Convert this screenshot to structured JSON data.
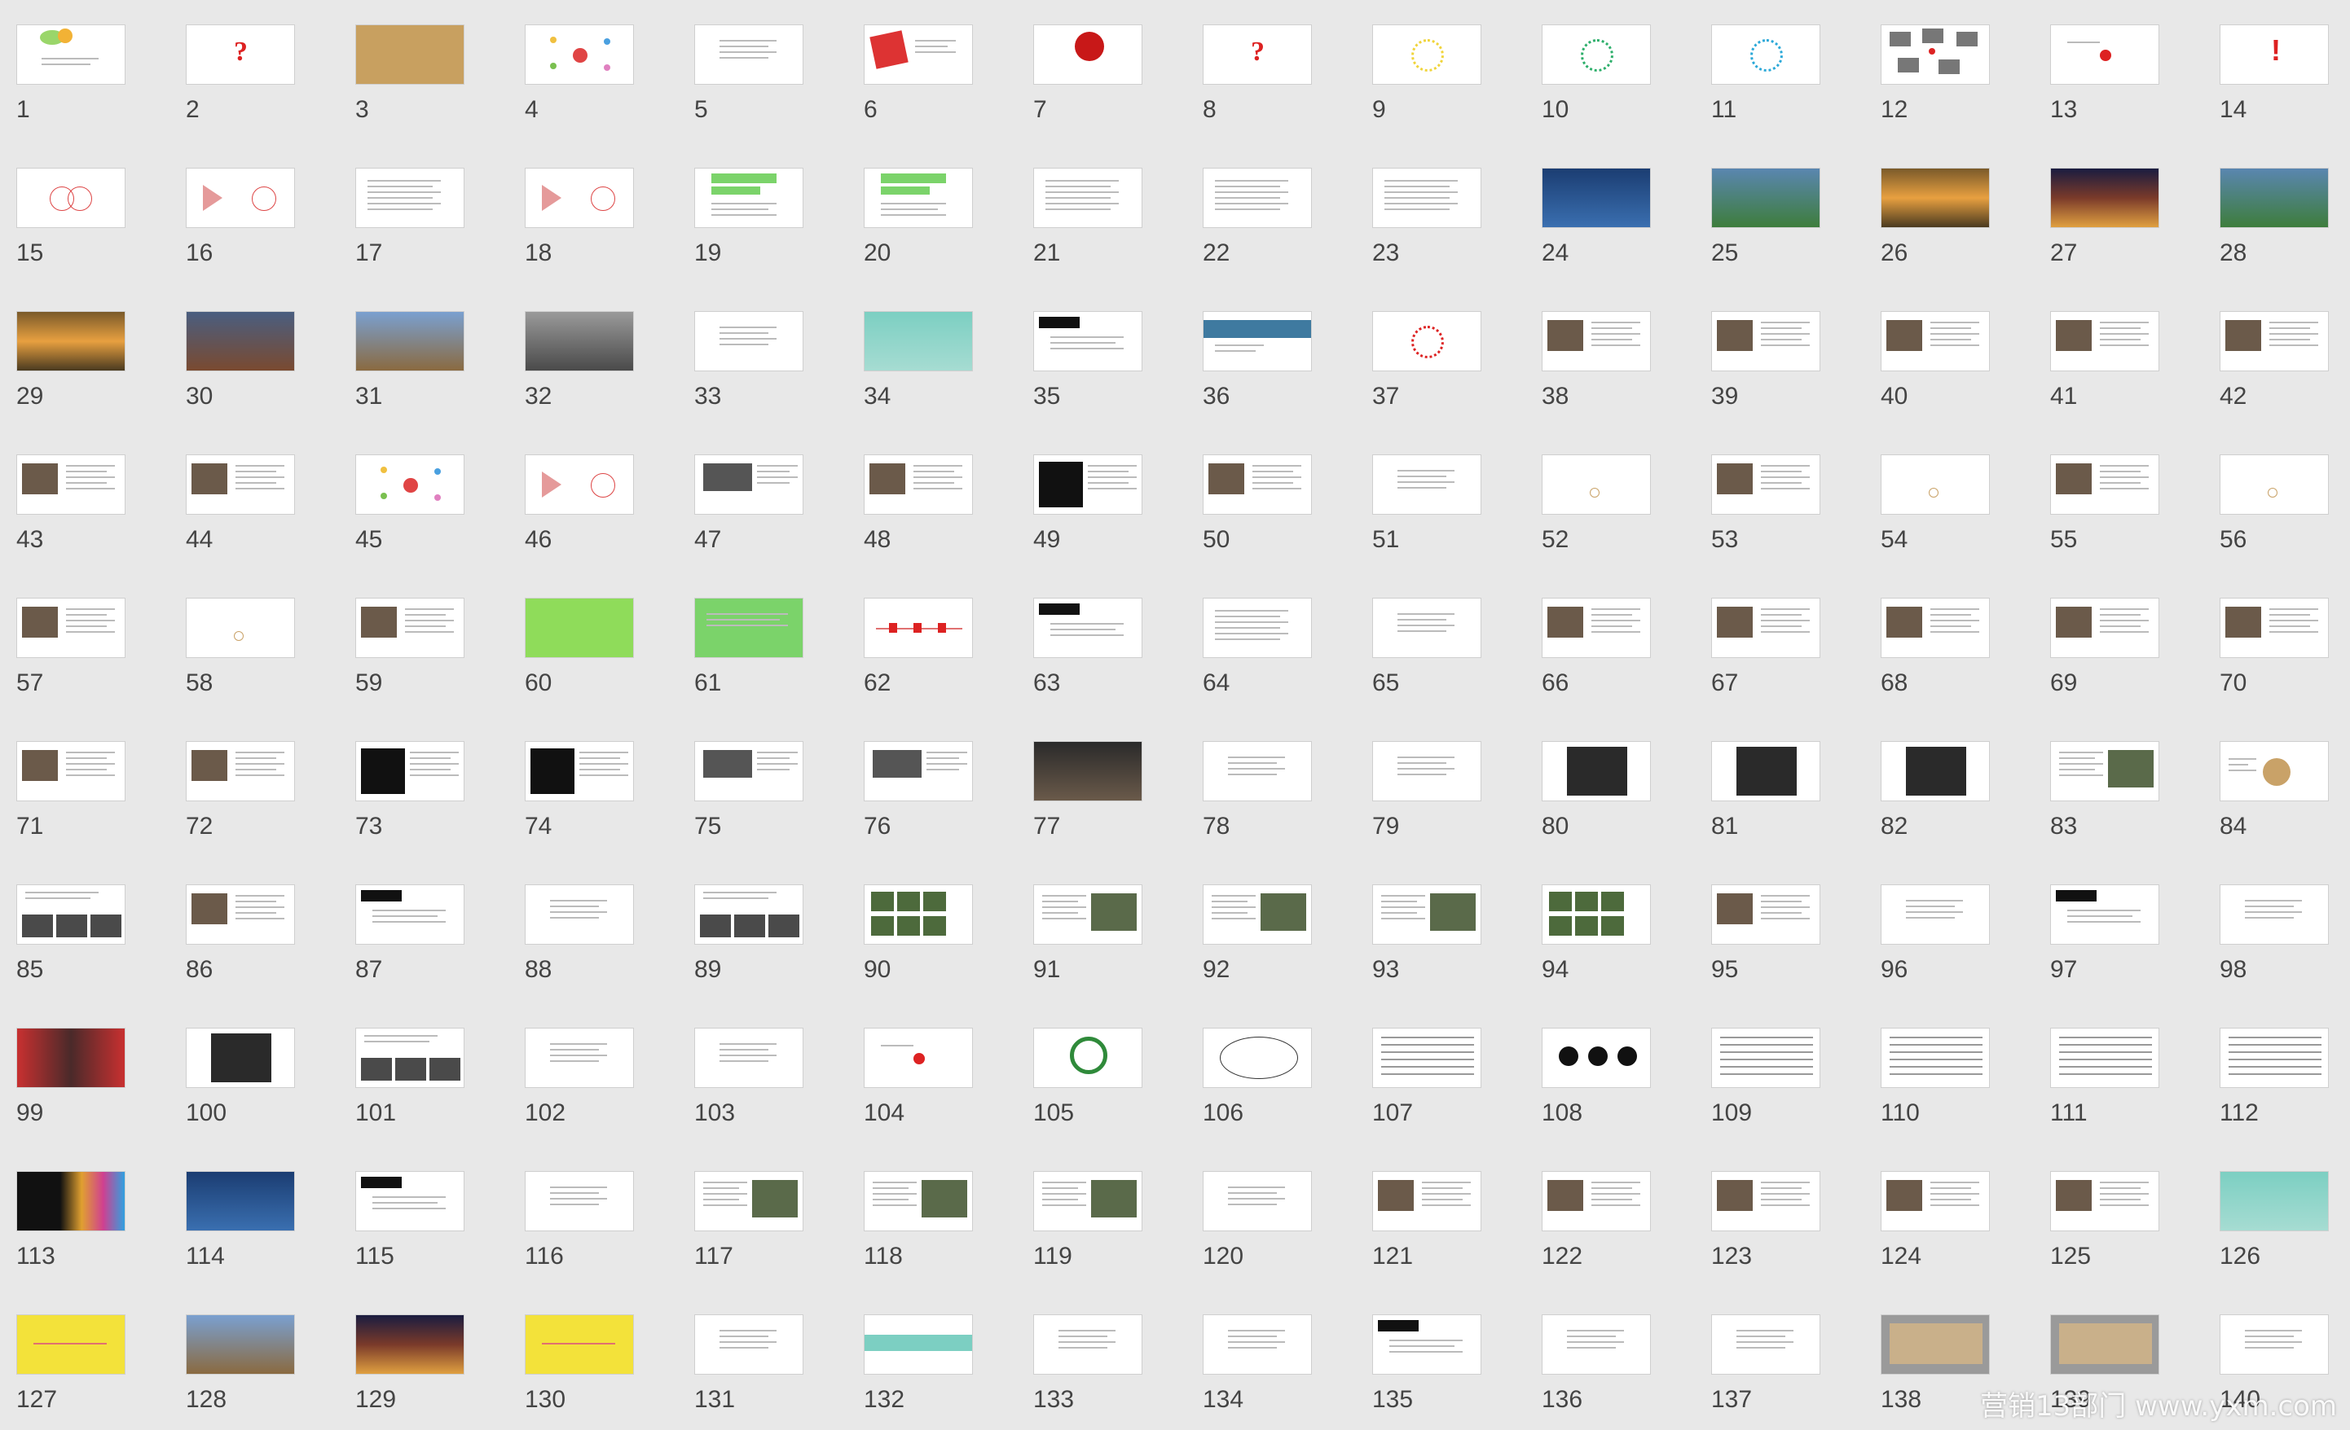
{
  "app": {
    "view": "slide-sorter"
  },
  "watermark": "营销13部门 www.yxm.com",
  "colors": {
    "background": "#e8e8e8",
    "number_text": "#444444",
    "accent_red": "#dd2222",
    "accent_green": "#7bd36a",
    "accent_yellow": "#f3e23a"
  },
  "slides": [
    {
      "n": "1",
      "kind": "title-flowers"
    },
    {
      "n": "2",
      "kind": "question"
    },
    {
      "n": "3",
      "kind": "photo-warm"
    },
    {
      "n": "4",
      "kind": "mindmap"
    },
    {
      "n": "5",
      "kind": "text"
    },
    {
      "n": "6",
      "kind": "book"
    },
    {
      "n": "7",
      "kind": "red-seal"
    },
    {
      "n": "8",
      "kind": "question"
    },
    {
      "n": "9",
      "kind": "burst-yellow"
    },
    {
      "n": "10",
      "kind": "burst-green"
    },
    {
      "n": "11",
      "kind": "burst-blue"
    },
    {
      "n": "12",
      "kind": "collage"
    },
    {
      "n": "13",
      "kind": "red-dot"
    },
    {
      "n": "14",
      "kind": "exclaim"
    },
    {
      "n": "15",
      "kind": "circles"
    },
    {
      "n": "16",
      "kind": "triangle-circle"
    },
    {
      "n": "17",
      "kind": "list"
    },
    {
      "n": "18",
      "kind": "triangle-circle"
    },
    {
      "n": "19",
      "kind": "chat-green"
    },
    {
      "n": "20",
      "kind": "chat-green"
    },
    {
      "n": "21",
      "kind": "list"
    },
    {
      "n": "22",
      "kind": "list"
    },
    {
      "n": "23",
      "kind": "list"
    },
    {
      "n": "24",
      "kind": "photo-blue"
    },
    {
      "n": "25",
      "kind": "photo-green"
    },
    {
      "n": "26",
      "kind": "photo-sunset"
    },
    {
      "n": "27",
      "kind": "photo-night"
    },
    {
      "n": "28",
      "kind": "photo-green"
    },
    {
      "n": "29",
      "kind": "photo-sunset"
    },
    {
      "n": "30",
      "kind": "photo-brown"
    },
    {
      "n": "31",
      "kind": "photo-temple"
    },
    {
      "n": "32",
      "kind": "photo-gray"
    },
    {
      "n": "33",
      "kind": "text"
    },
    {
      "n": "34",
      "kind": "photo-teal"
    },
    {
      "n": "35",
      "kind": "black-banner"
    },
    {
      "n": "36",
      "kind": "photo-strip"
    },
    {
      "n": "37",
      "kind": "burst-red"
    },
    {
      "n": "38",
      "kind": "photo-left"
    },
    {
      "n": "39",
      "kind": "photo-left"
    },
    {
      "n": "40",
      "kind": "photo-left"
    },
    {
      "n": "41",
      "kind": "photo-left"
    },
    {
      "n": "42",
      "kind": "photo-left"
    },
    {
      "n": "43",
      "kind": "photo-left"
    },
    {
      "n": "44",
      "kind": "photo-left"
    },
    {
      "n": "45",
      "kind": "mindmap"
    },
    {
      "n": "46",
      "kind": "triangle-circle"
    },
    {
      "n": "47",
      "kind": "photo-mid"
    },
    {
      "n": "48",
      "kind": "photo-left"
    },
    {
      "n": "49",
      "kind": "photo-dark"
    },
    {
      "n": "50",
      "kind": "photo-left"
    },
    {
      "n": "51",
      "kind": "text"
    },
    {
      "n": "52",
      "kind": "blank-mark"
    },
    {
      "n": "53",
      "kind": "photo-left"
    },
    {
      "n": "54",
      "kind": "blank-mark"
    },
    {
      "n": "55",
      "kind": "photo-left"
    },
    {
      "n": "56",
      "kind": "blank-mark"
    },
    {
      "n": "57",
      "kind": "photo-left"
    },
    {
      "n": "58",
      "kind": "blank-mark"
    },
    {
      "n": "59",
      "kind": "photo-left"
    },
    {
      "n": "60",
      "kind": "solid-green"
    },
    {
      "n": "61",
      "kind": "solid-green-text"
    },
    {
      "n": "62",
      "kind": "timeline"
    },
    {
      "n": "63",
      "kind": "black-banner"
    },
    {
      "n": "64",
      "kind": "list"
    },
    {
      "n": "65",
      "kind": "text"
    },
    {
      "n": "66",
      "kind": "photo-left"
    },
    {
      "n": "67",
      "kind": "photo-left"
    },
    {
      "n": "68",
      "kind": "photo-left"
    },
    {
      "n": "69",
      "kind": "photo-left"
    },
    {
      "n": "70",
      "kind": "photo-left"
    },
    {
      "n": "71",
      "kind": "photo-left"
    },
    {
      "n": "72",
      "kind": "photo-left"
    },
    {
      "n": "73",
      "kind": "photo-dark"
    },
    {
      "n": "74",
      "kind": "photo-dark"
    },
    {
      "n": "75",
      "kind": "photo-mid"
    },
    {
      "n": "76",
      "kind": "photo-mid"
    },
    {
      "n": "77",
      "kind": "photo-full"
    },
    {
      "n": "78",
      "kind": "text"
    },
    {
      "n": "79",
      "kind": "text"
    },
    {
      "n": "80",
      "kind": "photo-center"
    },
    {
      "n": "81",
      "kind": "photo-center"
    },
    {
      "n": "82",
      "kind": "photo-center"
    },
    {
      "n": "83",
      "kind": "photo-right"
    },
    {
      "n": "84",
      "kind": "badge"
    },
    {
      "n": "85",
      "kind": "photo-row"
    },
    {
      "n": "86",
      "kind": "photo-left"
    },
    {
      "n": "87",
      "kind": "black-banner"
    },
    {
      "n": "88",
      "kind": "text"
    },
    {
      "n": "89",
      "kind": "photo-row"
    },
    {
      "n": "90",
      "kind": "photo-grid"
    },
    {
      "n": "91",
      "kind": "photo-right"
    },
    {
      "n": "92",
      "kind": "photo-right"
    },
    {
      "n": "93",
      "kind": "photo-right"
    },
    {
      "n": "94",
      "kind": "photo-grid"
    },
    {
      "n": "95",
      "kind": "photo-left"
    },
    {
      "n": "96",
      "kind": "text"
    },
    {
      "n": "97",
      "kind": "black-banner"
    },
    {
      "n": "98",
      "kind": "text"
    },
    {
      "n": "99",
      "kind": "photo-red"
    },
    {
      "n": "100",
      "kind": "photo-center"
    },
    {
      "n": "101",
      "kind": "photo-row"
    },
    {
      "n": "102",
      "kind": "text"
    },
    {
      "n": "103",
      "kind": "text"
    },
    {
      "n": "104",
      "kind": "red-dot"
    },
    {
      "n": "105",
      "kind": "green-cycle"
    },
    {
      "n": "106",
      "kind": "diagram"
    },
    {
      "n": "107",
      "kind": "table"
    },
    {
      "n": "108",
      "kind": "black-circles"
    },
    {
      "n": "109",
      "kind": "table"
    },
    {
      "n": "110",
      "kind": "table"
    },
    {
      "n": "111",
      "kind": "table"
    },
    {
      "n": "112",
      "kind": "table"
    },
    {
      "n": "113",
      "kind": "photo-colorful"
    },
    {
      "n": "114",
      "kind": "photo-blue"
    },
    {
      "n": "115",
      "kind": "black-banner"
    },
    {
      "n": "116",
      "kind": "text"
    },
    {
      "n": "117",
      "kind": "photo-right"
    },
    {
      "n": "118",
      "kind": "photo-right"
    },
    {
      "n": "119",
      "kind": "photo-right"
    },
    {
      "n": "120",
      "kind": "text"
    },
    {
      "n": "121",
      "kind": "photo-left"
    },
    {
      "n": "122",
      "kind": "photo-left"
    },
    {
      "n": "123",
      "kind": "photo-left"
    },
    {
      "n": "124",
      "kind": "photo-left"
    },
    {
      "n": "125",
      "kind": "photo-left"
    },
    {
      "n": "126",
      "kind": "photo-teal"
    },
    {
      "n": "127",
      "kind": "solid-yellow"
    },
    {
      "n": "128",
      "kind": "photo-temple"
    },
    {
      "n": "129",
      "kind": "photo-night"
    },
    {
      "n": "130",
      "kind": "solid-yellow"
    },
    {
      "n": "131",
      "kind": "text"
    },
    {
      "n": "132",
      "kind": "photo-teal-strip"
    },
    {
      "n": "133",
      "kind": "text"
    },
    {
      "n": "134",
      "kind": "text"
    },
    {
      "n": "135",
      "kind": "black-banner"
    },
    {
      "n": "136",
      "kind": "text"
    },
    {
      "n": "137",
      "kind": "text"
    },
    {
      "n": "138",
      "kind": "photo-frame"
    },
    {
      "n": "139",
      "kind": "photo-frame"
    },
    {
      "n": "140",
      "kind": "text"
    }
  ]
}
